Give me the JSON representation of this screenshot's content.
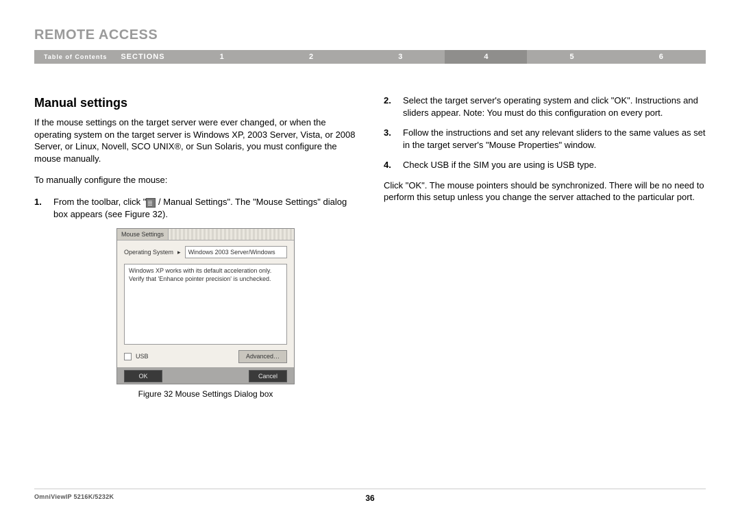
{
  "header": {
    "title": "REMOTE ACCESS"
  },
  "nav": {
    "toc": "Table of Contents",
    "sections_label": "SECTIONS",
    "items": [
      "1",
      "2",
      "3",
      "4",
      "5",
      "6"
    ],
    "active_index": 3
  },
  "left": {
    "subtitle": "Manual settings",
    "intro": "If the mouse settings on the target server were ever changed, or when the operating system on the target server is Windows XP, 2003 Server, Vista, or 2008 Server, or Linux, Novell, SCO UNIX®, or Sun Solaris, you must configure the mouse manually.",
    "lead": "To manually configure the mouse:",
    "step1_num": "1.",
    "step1_pre": "From the toolbar, click \"",
    "step1_post": " / Manual Settings\". The \"Mouse Settings\" dialog box appears (see Figure 32).",
    "caption": "Figure 32 Mouse Settings Dialog box"
  },
  "dialog": {
    "title": "Mouse Settings",
    "os_label": "Operating System",
    "os_arrow": "▸",
    "os_value": "Windows 2003 Server/Windows",
    "message": "Windows XP works with its default acceleration only. Verify that 'Enhance pointer precision' is unchecked.",
    "usb_label": "USB",
    "advanced": "Advanced…",
    "ok": "OK",
    "cancel": "Cancel"
  },
  "right": {
    "step2_num": "2.",
    "step2": "Select the target server's operating system and click \"OK\". Instructions and sliders appear. Note: You must do this configuration on every port.",
    "step3_num": "3.",
    "step3": "Follow the instructions and set any relevant sliders to the same values as set in the target server's \"Mouse Properties\" window.",
    "step4_num": "4.",
    "step4": "Check USB if the SIM you are using is USB type.",
    "closing": "Click \"OK\". The mouse pointers should be synchronized. There will be no need to perform this setup unless you change the server attached to the particular port."
  },
  "footer": {
    "product": "OmniViewIP 5216K/5232K",
    "page": "36"
  }
}
